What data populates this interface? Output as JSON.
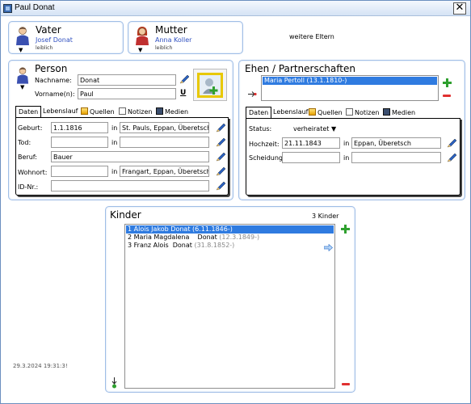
{
  "window": {
    "title": "Paul Donat",
    "close_symbol": "✕"
  },
  "vater": {
    "title": "Vater",
    "name": "Josef Donat",
    "status": "leiblich"
  },
  "mutter": {
    "title": "Mutter",
    "name": "Anna Koller",
    "status": "leiblich"
  },
  "weitere_eltern": "weitere Eltern",
  "person": {
    "title": "Person",
    "nachname_label": "Nachname:",
    "nachname": "Donat",
    "vorname_label": "Vorname(n):",
    "vorname": "Paul",
    "u_marker": "U",
    "tabs": [
      "Daten",
      "Lebenslauf",
      "Quellen",
      "Notizen",
      "Medien"
    ],
    "in_label": "in",
    "fields": {
      "geburt_label": "Geburt:",
      "geburt_date": "1.1.1816",
      "geburt_place": "St. Pauls, Eppan, Überetsch",
      "tod_label": "Tod:",
      "tod_date": "",
      "tod_place": "",
      "beruf_label": "Beruf:",
      "beruf": "Bauer",
      "wohnort_label": "Wohnort:",
      "wohnort_date": "",
      "wohnort_place": "Frangart, Eppan, Überetsch",
      "id_label": "ID-Nr.:",
      "id": ""
    }
  },
  "ehen": {
    "title": "Ehen / Partnerschaften",
    "partners": [
      {
        "name": "Maria Pertoll",
        "date": "(13.1.1810-)"
      }
    ],
    "tabs": [
      "Daten",
      "Lebenslauf",
      "Quellen",
      "Notizen",
      "Medien"
    ],
    "status_label": "Status:",
    "status_value": "verheiratet",
    "hochzeit_label": "Hochzeit:",
    "hochzeit_date": "21.11.1843",
    "hochzeit_in": "in",
    "hochzeit_place": "Eppan, Überetsch",
    "scheidung_label": "Scheidung:",
    "scheidung_date": "",
    "scheidung_in": "in",
    "scheidung_place": ""
  },
  "kinder": {
    "title": "Kinder",
    "count": "3 Kinder",
    "items": [
      {
        "num": "1",
        "name": "Alois Jakob Donat",
        "date": "(6.11.1846-)"
      },
      {
        "num": "2",
        "name": "Maria Magdalena    Donat",
        "date": "(12.3.1849-)"
      },
      {
        "num": "3",
        "name": "Franz Alois  Donat",
        "date": "(31.8.1852-)"
      }
    ]
  },
  "timestamp": "29.3.2024 19:31:3!",
  "colors": {
    "accent": "#2f7be0",
    "panel_border": "#9fbde6",
    "add": "#2fa02f",
    "remove": "#e03030"
  }
}
